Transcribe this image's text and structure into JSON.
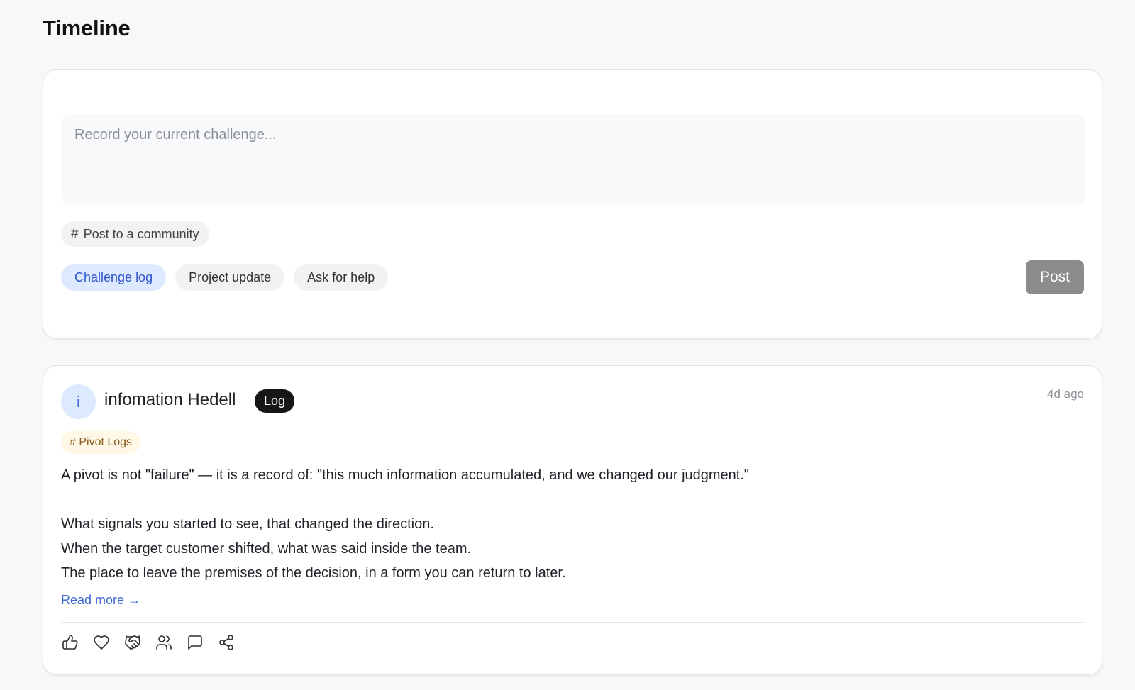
{
  "page": {
    "title": "Timeline"
  },
  "composer": {
    "placeholder": "Record your current challenge...",
    "community_button": "Post to a community",
    "post_types": [
      {
        "label": "Challenge log",
        "active": true
      },
      {
        "label": "Project update",
        "active": false
      },
      {
        "label": "Ask for help",
        "active": false
      }
    ],
    "post_button": "Post"
  },
  "post": {
    "avatar_initial": "i",
    "author": "infomation Hedell",
    "badge": "Log",
    "time": "4d ago",
    "community_tag": "# Pivot Logs",
    "paragraphs": [
      "A pivot is not \"failure\" — it is a record of: \"this much information accumulated, and we changed our judgment.\"",
      "",
      "What signals you started to see, that changed the direction.",
      "When the target customer shifted, what was said inside the team.",
      "The place to leave the premises of the decision, in a form you can return to later."
    ],
    "read_more": "Read more →",
    "actions": [
      "thumbs-up-icon",
      "heart-icon",
      "handshake-icon",
      "users-icon",
      "comment-icon",
      "share-icon"
    ]
  }
}
